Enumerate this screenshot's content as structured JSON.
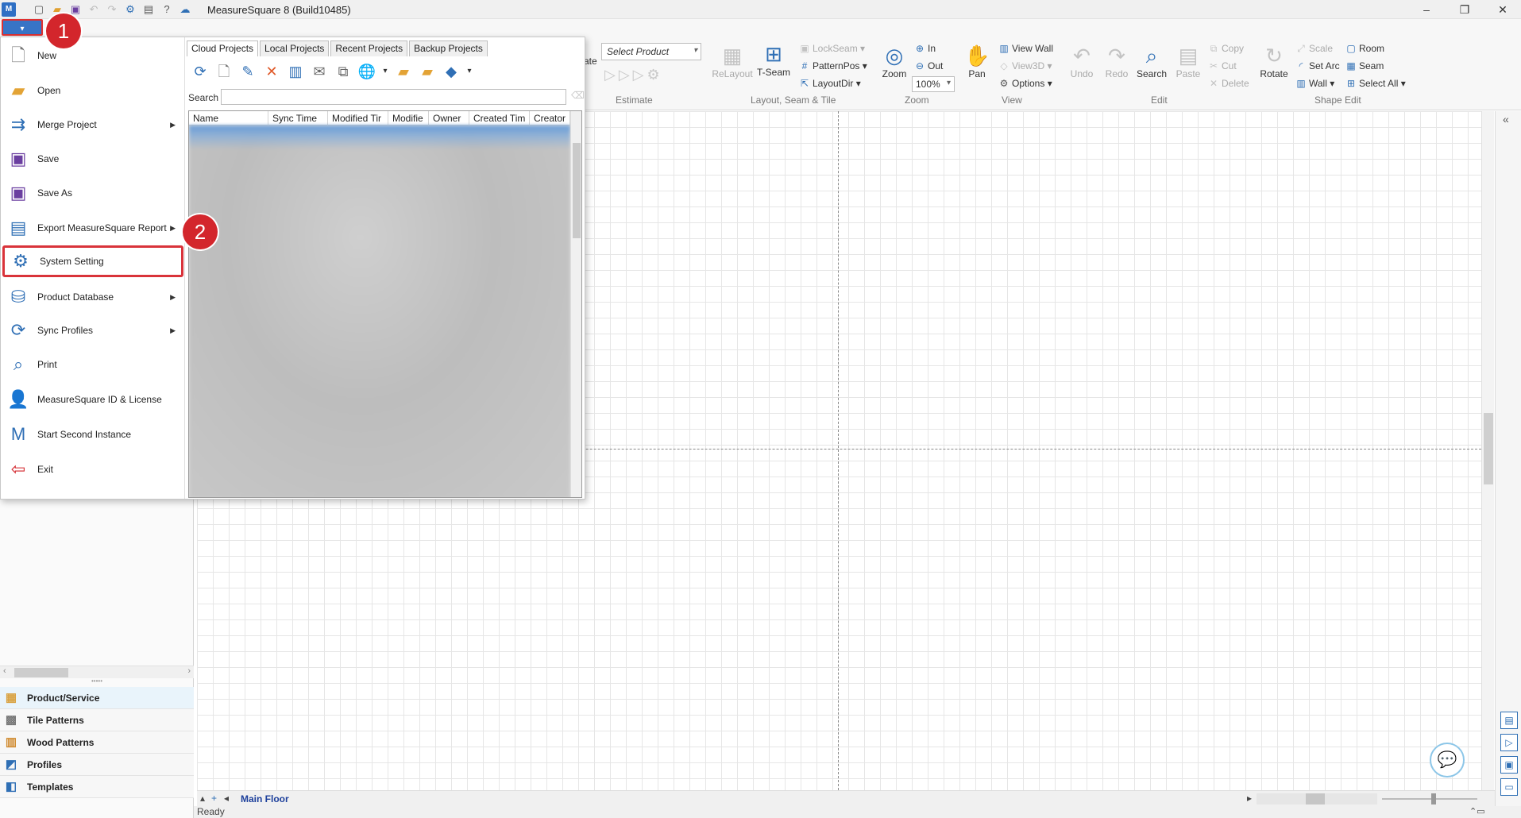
{
  "window": {
    "title": "MeasureSquare 8 (Build10485)",
    "logo_text": "M",
    "controls": {
      "minimize": "–",
      "restore": "❐",
      "close": "✕"
    }
  },
  "quick_access": [
    "new-icon",
    "open-icon",
    "save-icon",
    "undo-icon",
    "redo-icon",
    "settings-icon",
    "report-icon",
    "help-icon",
    "cloud-icon"
  ],
  "ribbon": {
    "estimate": {
      "label": "Estimate",
      "select_product": "Select Product",
      "partial_label": "ate"
    },
    "layout": {
      "label": "Layout, Seam & Tile",
      "relayout": "ReLayout",
      "tseam": "T-Seam",
      "lockseam": "LockSeam",
      "patternpos": "PatternPos",
      "layoutdir": "LayoutDir"
    },
    "zoom": {
      "label": "Zoom",
      "zoom": "Zoom",
      "in": "In",
      "out": "Out",
      "level": "100%"
    },
    "view": {
      "label": "View",
      "pan": "Pan",
      "view_wall": "View Wall",
      "view3d": "View3D",
      "options": "Options"
    },
    "edit": {
      "label": "Edit",
      "undo": "Undo",
      "redo": "Redo",
      "search": "Search",
      "paste": "Paste",
      "copy": "Copy",
      "cut": "Cut",
      "delete": "Delete"
    },
    "shape_edit": {
      "label": "Shape Edit",
      "rotate": "Rotate",
      "scale": "Scale",
      "set_arc": "Set Arc",
      "wall": "Wall",
      "room": "Room",
      "seam": "Seam",
      "select_all": "Select All"
    }
  },
  "app_menu": {
    "items": [
      {
        "label": "New",
        "icon": "new-file-icon",
        "submenu": false
      },
      {
        "label": "Open",
        "icon": "folder-open-icon",
        "submenu": false
      },
      {
        "label": "Merge Project",
        "icon": "merge-icon",
        "submenu": true
      },
      {
        "label": "Save",
        "icon": "save-icon",
        "submenu": false
      },
      {
        "label": "Save As",
        "icon": "save-as-icon",
        "submenu": false
      },
      {
        "label": "Export MeasureSquare Report",
        "icon": "export-report-icon",
        "submenu": true
      },
      {
        "label": "System Setting",
        "icon": "gear-icon",
        "submenu": false
      },
      {
        "label": "Product Database",
        "icon": "database-icon",
        "submenu": true
      },
      {
        "label": "Sync Profiles",
        "icon": "sync-icon",
        "submenu": true
      },
      {
        "label": "Print",
        "icon": "print-preview-icon",
        "submenu": false
      },
      {
        "label": "MeasureSquare ID & License",
        "icon": "user-license-icon",
        "submenu": false
      },
      {
        "label": "Start Second Instance",
        "icon": "app-instance-icon",
        "submenu": false
      },
      {
        "label": "Exit",
        "icon": "exit-icon",
        "submenu": false
      }
    ],
    "highlighted_item": "System Setting",
    "tabs": [
      "Cloud Projects",
      "Local Projects",
      "Recent Projects",
      "Backup Projects"
    ],
    "active_tab": "Cloud Projects",
    "search_label": "Search",
    "search_value": "",
    "columns": [
      "Name",
      "Sync Time",
      "Modified Tir",
      "Modifie",
      "Owner",
      "Created Tim",
      "Creator"
    ]
  },
  "annotations": {
    "step1": "1",
    "step2": "2",
    "accent": "#d3262c"
  },
  "left_pane": {
    "nav": [
      {
        "label": "Product/Service",
        "icon": "product-service-icon"
      },
      {
        "label": "Tile Patterns",
        "icon": "tile-pattern-icon"
      },
      {
        "label": "Wood Patterns",
        "icon": "wood-pattern-icon"
      },
      {
        "label": "Profiles",
        "icon": "profiles-icon"
      },
      {
        "label": "Templates",
        "icon": "templates-icon"
      }
    ]
  },
  "bottom": {
    "floor_tab": "Main Floor",
    "status": "Ready"
  },
  "colors": {
    "brand": "#2f6fb5",
    "highlight_border": "#d9333a",
    "floor_tab": "#1c3f9b"
  }
}
